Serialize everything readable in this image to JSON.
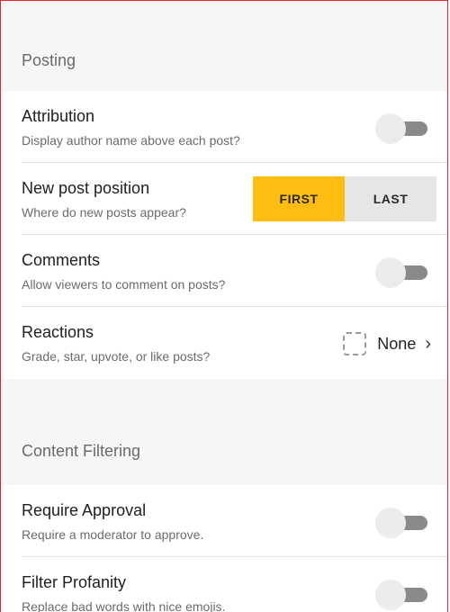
{
  "sections": {
    "posting": {
      "header": "Posting",
      "attribution": {
        "title": "Attribution",
        "subtitle": "Display author name above each post?"
      },
      "new_post_position": {
        "title": "New post position",
        "subtitle": "Where do new posts appear?",
        "options": [
          "FIRST",
          "LAST"
        ],
        "selected": "FIRST"
      },
      "comments": {
        "title": "Comments",
        "subtitle": "Allow viewers to comment on posts?"
      },
      "reactions": {
        "title": "Reactions",
        "subtitle": "Grade, star, upvote, or like posts?",
        "value": "None",
        "chevron": "›"
      }
    },
    "content_filtering": {
      "header": "Content Filtering",
      "require_approval": {
        "title": "Require Approval",
        "subtitle": "Require a moderator to approve."
      },
      "filter_profanity": {
        "title": "Filter Profanity",
        "subtitle": "Replace bad words with nice emojis."
      }
    }
  },
  "toggles": {
    "attribution": "off",
    "comments": "off",
    "require_approval": "off",
    "filter_profanity": "off"
  },
  "colors": {
    "accent": "#ffbd12",
    "section_background": "#f6f6f6",
    "toggle_track": "#8a8a8a",
    "toggle_thumb": "#ececec",
    "frame_border": "#e3262b"
  },
  "icons": {
    "reaction_placeholder": "dashed-square-icon",
    "chevron": "chevron-right-icon"
  }
}
